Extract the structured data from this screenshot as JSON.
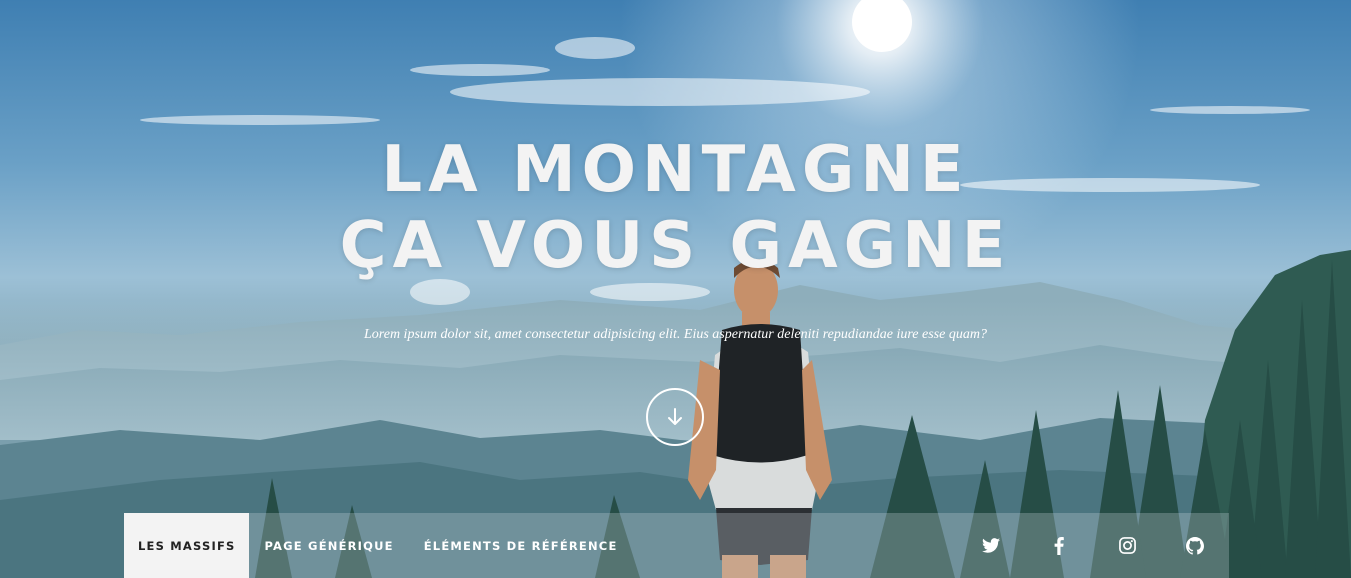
{
  "hero": {
    "title_line1": "LA MONTAGNE",
    "title_line2": "ÇA VOUS GAGNE",
    "subtitle": "Lorem ipsum dolor sit, amet consectetur adipisicing elit. Eius aspernatur deleniti repudiandae iure esse quam?",
    "scroll_icon": "arrow-down-icon"
  },
  "nav": {
    "items": [
      {
        "label": "LES MASSIFS",
        "active": true
      },
      {
        "label": "PAGE GÉNÉRIQUE",
        "active": false
      },
      {
        "label": "ÉLÉMENTS DE RÉFÉRENCE",
        "active": false
      }
    ],
    "social": [
      "twitter-icon",
      "facebook-icon",
      "instagram-icon",
      "github-icon"
    ]
  },
  "colors": {
    "text": "#ffffff",
    "active_bg": "#f3f3f3",
    "active_text": "#222222"
  }
}
